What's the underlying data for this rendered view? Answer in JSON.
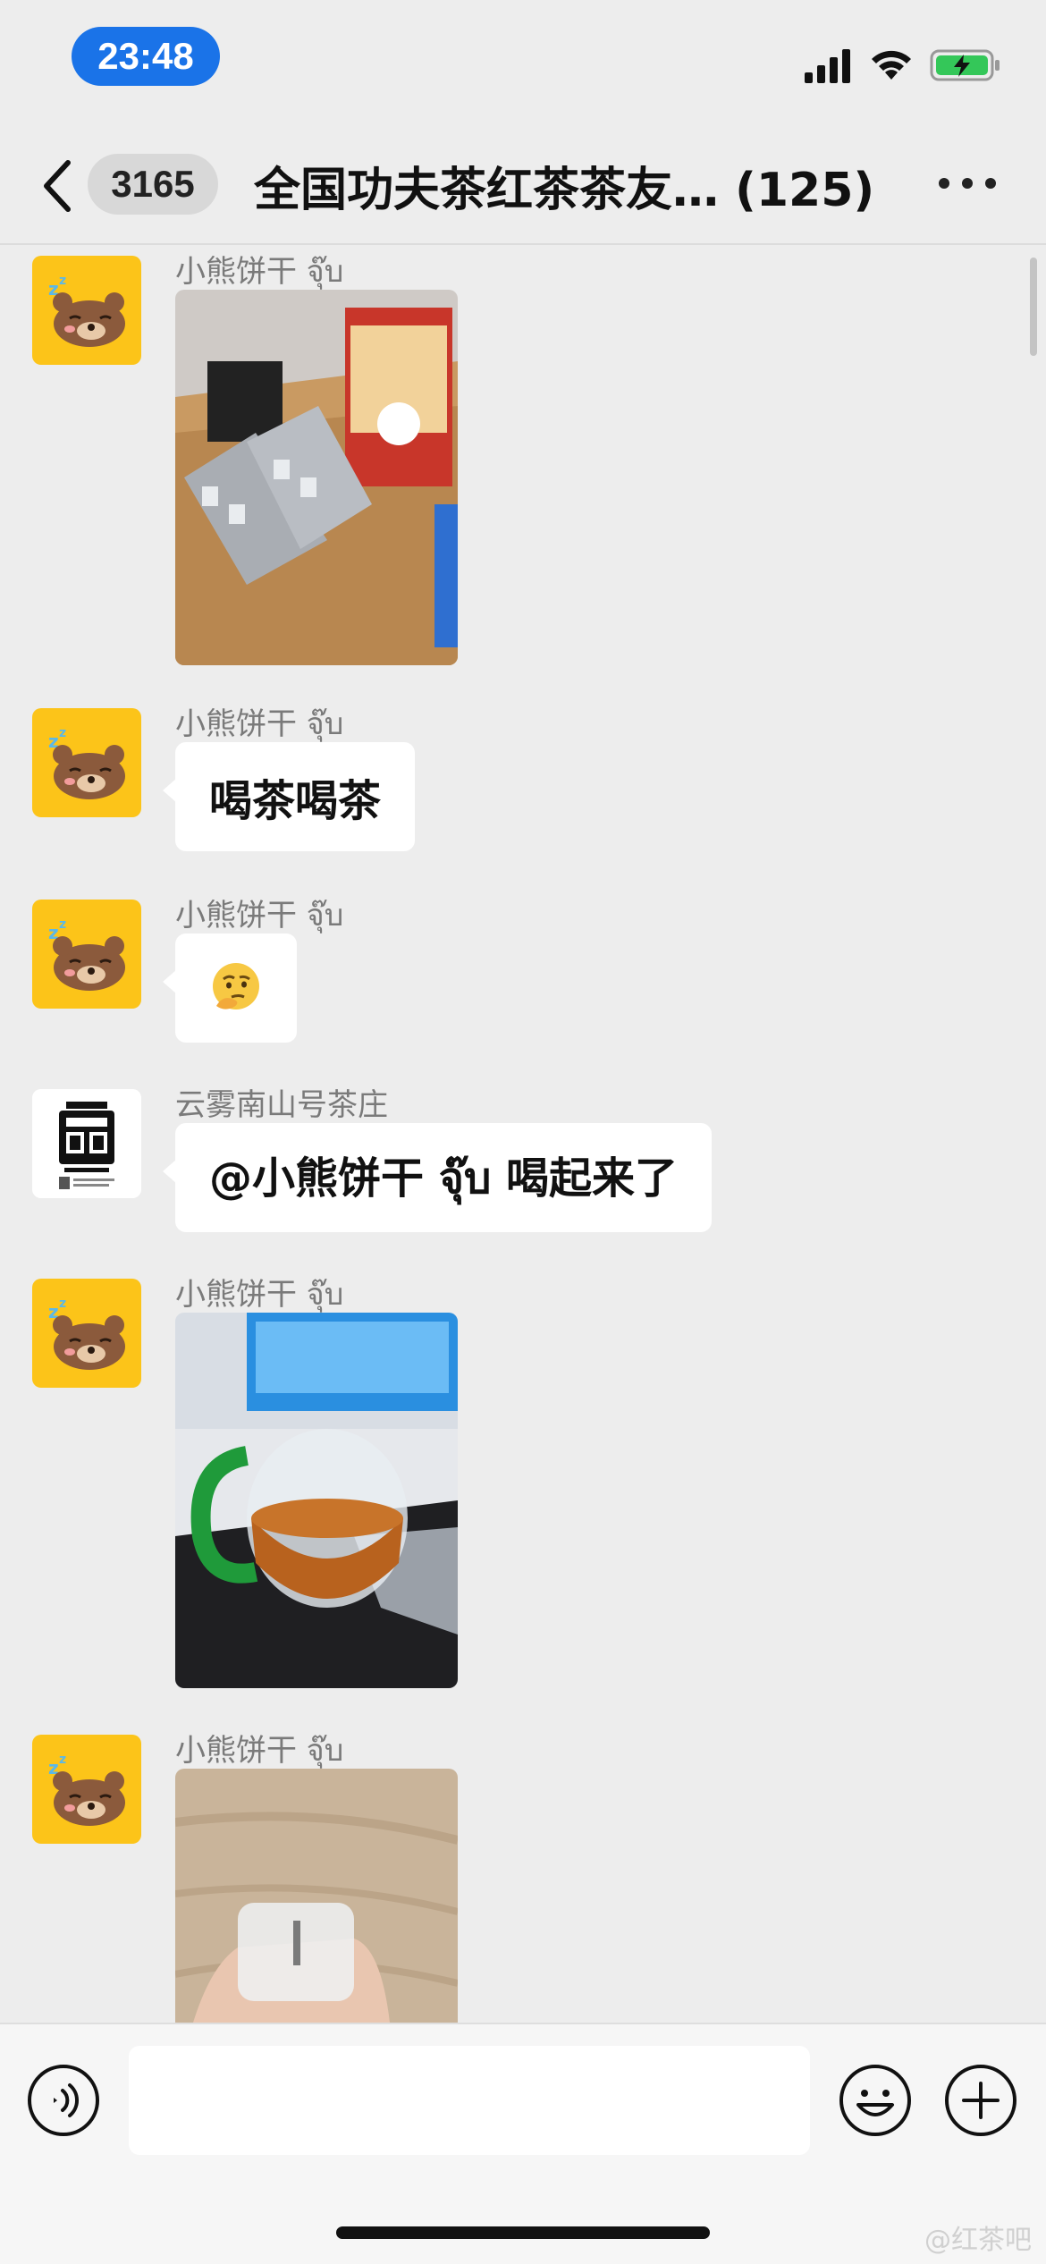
{
  "status_bar": {
    "time": "23:48"
  },
  "nav": {
    "unread_count": "3165",
    "title": "全国功夫茶红茶茶友… (125)"
  },
  "messages": [
    {
      "sender": "小熊饼干 จุ๊บ",
      "type": "image",
      "avatar": "bear-avatar"
    },
    {
      "sender": "小熊饼干 จุ๊บ",
      "type": "text",
      "text": "喝茶喝茶",
      "avatar": "bear-avatar"
    },
    {
      "sender": "小熊饼干 จุ๊บ",
      "type": "emoji",
      "text": "🤔",
      "avatar": "bear-avatar"
    },
    {
      "sender": "云雾南山号茶庄",
      "type": "text",
      "text": "@小熊饼干 จุ๊บ 喝起来了",
      "avatar": "tea-house-logo"
    },
    {
      "sender": "小熊饼干 จุ๊บ",
      "type": "image",
      "avatar": "bear-avatar"
    },
    {
      "sender": "小熊饼干 จุ๊บ",
      "type": "image",
      "avatar": "bear-avatar"
    }
  ],
  "input": {
    "value": "",
    "placeholder": ""
  },
  "watermark": "@红茶吧",
  "colors": {
    "time_pill": "#1a73e8",
    "avatar_bg": "#fcc419",
    "chat_bg": "#ededed",
    "bubble": "#ffffff"
  },
  "icons": [
    "back-chevron-icon",
    "more-dots-icon",
    "signal-icon",
    "wifi-icon",
    "battery-charging-icon",
    "voice-icon",
    "emoji-icon",
    "add-icon"
  ]
}
